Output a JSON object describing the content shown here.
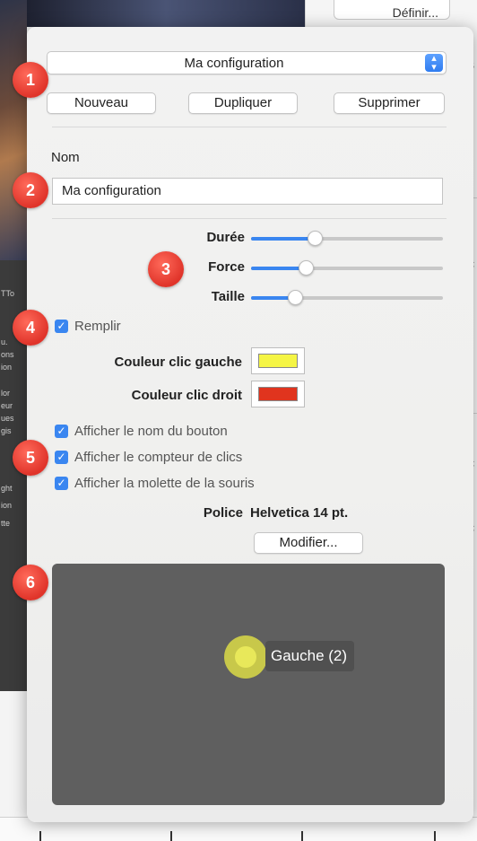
{
  "background": {
    "define_button": "Définir...",
    "right_fragments": [
      "s",
      "c",
      "c",
      "c"
    ],
    "left_sidebar_text": [
      "TTo",
      "u.",
      "ons",
      "ion",
      "lor",
      "eur",
      "ues",
      "gis",
      "ght",
      "ion",
      "tte"
    ]
  },
  "popover": {
    "config_popup": {
      "selected": "Ma configuration"
    },
    "buttons": {
      "new": "Nouveau",
      "duplicate": "Dupliquer",
      "delete": "Supprimer"
    },
    "name_label": "Nom",
    "name_value": "Ma configuration",
    "sliders": [
      {
        "label": "Durée",
        "value": 0.32
      },
      {
        "label": "Force",
        "value": 0.27
      },
      {
        "label": "Taille",
        "value": 0.21
      }
    ],
    "fill_checkbox": {
      "label": "Remplir",
      "checked": true
    },
    "left_click_color": {
      "label": "Couleur clic gauche",
      "color": "#f5f545"
    },
    "right_click_color": {
      "label": "Couleur clic droit",
      "color": "#e0341e"
    },
    "options": [
      {
        "label": "Afficher le nom du bouton",
        "checked": true
      },
      {
        "label": "Afficher le compteur de clics",
        "checked": true
      },
      {
        "label": "Afficher la molette de la souris",
        "checked": true
      }
    ],
    "font_label": "Police",
    "font_value": "Helvetica 14 pt.",
    "modify_button": "Modifier...",
    "preview": {
      "cursor_label": "Gauche (2)"
    }
  },
  "callouts": [
    "1",
    "2",
    "3",
    "4",
    "5",
    "6"
  ],
  "colors": {
    "accent": "#3a86f0",
    "callout": "#e0342a"
  }
}
